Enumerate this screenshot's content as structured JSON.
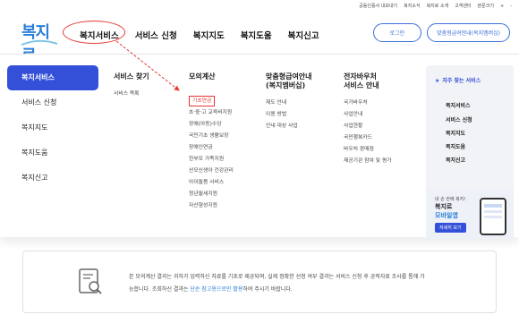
{
  "topbar": {
    "links": [
      "공동인증서 내보내기",
      "복지소식",
      "복지로 소개",
      "고객센터",
      "본문크기",
      "+",
      "-"
    ]
  },
  "logo": {
    "text": "복지로"
  },
  "gnb": {
    "items": [
      "복지서비스",
      "서비스 신청",
      "복지지도",
      "복지도움",
      "복지신고"
    ]
  },
  "header_buttons": {
    "login": "로그인",
    "custom_guide": "맞춤형급여안내(복지멤버십)"
  },
  "side_menu": [
    "복지서비스",
    "서비스 신청",
    "복지지도",
    "복지도움",
    "복지신고"
  ],
  "columns": [
    {
      "title": "서비스 찾기",
      "items": [
        "서비스 목록"
      ]
    },
    {
      "title": "모의계산",
      "items": [
        "기초연금",
        "초·중·고 교육비지원",
        "장애(아동)수당",
        "국민기초 생활보장",
        "장애인연금",
        "한부모 가족지원",
        "산모신생아 건강관리",
        "아이돌봄 서비스",
        "청년월세지원",
        "자산형성지원"
      ]
    },
    {
      "title_line1": "맞춤형급여안내",
      "title_line2": "(복지멤버십)",
      "items": [
        "제도 안내",
        "이용 방법",
        "안내 대상 사업"
      ]
    },
    {
      "title_line1": "전자바우처",
      "title_line2": "서비스 안내",
      "items": [
        "국가바우처",
        "사업안내",
        "사업현황",
        "국민행복카드",
        "바우처 판매점",
        "제공기관 참여 및 평가"
      ]
    }
  ],
  "favorites": {
    "title": "자주 찾는 서비스",
    "items": [
      "복지서비스",
      "서비스 신청",
      "복지지도",
      "복지도움",
      "복지신고"
    ]
  },
  "promo": {
    "small": "내 손 안에 복지!",
    "title": "복지로",
    "subtitle": "모바일앱",
    "button": "자세히 보기"
  },
  "info": {
    "text1": "본 모의계산 결과는 귀하가 입력하신 자료를 기초로 제공되며, 실제 정확한 선정 여부 결과는 서비스 신청 후 공적자료 조사를 통해 가",
    "text2_a": "능합니다. 조회하신 결과는 ",
    "text2_hl": "단순 참고용으로만 활용",
    "text2_b": "하여 주시기 바랍니다."
  },
  "colors": {
    "primary": "#3550d8",
    "highlight": "#e53935",
    "link": "#2b7fd6"
  }
}
